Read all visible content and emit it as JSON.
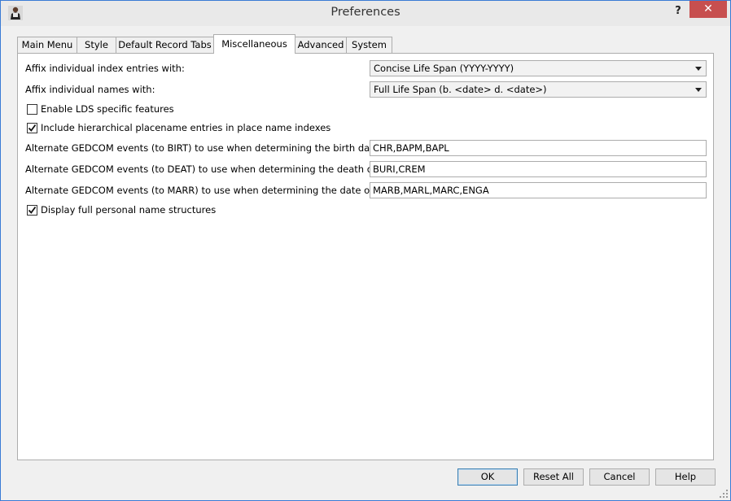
{
  "window": {
    "title": "Preferences",
    "help_label": "?",
    "close_label": "✕"
  },
  "tabs": [
    {
      "label": "Main Menu"
    },
    {
      "label": "Style"
    },
    {
      "label": "Default Record Tabs"
    },
    {
      "label": "Miscellaneous",
      "active": true
    },
    {
      "label": "Advanced"
    },
    {
      "label": "System"
    }
  ],
  "misc": {
    "affix_index_label": "Affix individual index entries with:",
    "affix_index_value": "Concise Life Span (YYYY-YYYY)",
    "affix_names_label": "Affix individual names with:",
    "affix_names_value": "Full Life Span (b. <date> d. <date>)",
    "lds_label": "Enable LDS specific features",
    "lds_checked": false,
    "hier_label": "Include hierarchical placename entries in place name indexes",
    "hier_checked": true,
    "birt_label": "Alternate GEDCOM events (to BIRT) to use when determining the birth date:",
    "birt_value": "CHR,BAPM,BAPL",
    "deat_label": "Alternate GEDCOM events (to DEAT) to use when determining the death date:",
    "deat_value": "BURI,CREM",
    "marr_label": "Alternate GEDCOM events (to MARR) to use when determining the date of a marriage:",
    "marr_value": "MARB,MARL,MARC,ENGA",
    "fullname_label": "Display full personal name structures",
    "fullname_checked": true
  },
  "buttons": {
    "ok": "OK",
    "reset_all": "Reset All",
    "cancel": "Cancel",
    "help": "Help"
  },
  "colors": {
    "close_button": "#c74f4f",
    "default_button_border": "#3c7fb1"
  },
  "icons": {
    "app": "person-figure-icon",
    "dropdown": "chevron-down-icon",
    "check": "checkmark-icon"
  }
}
